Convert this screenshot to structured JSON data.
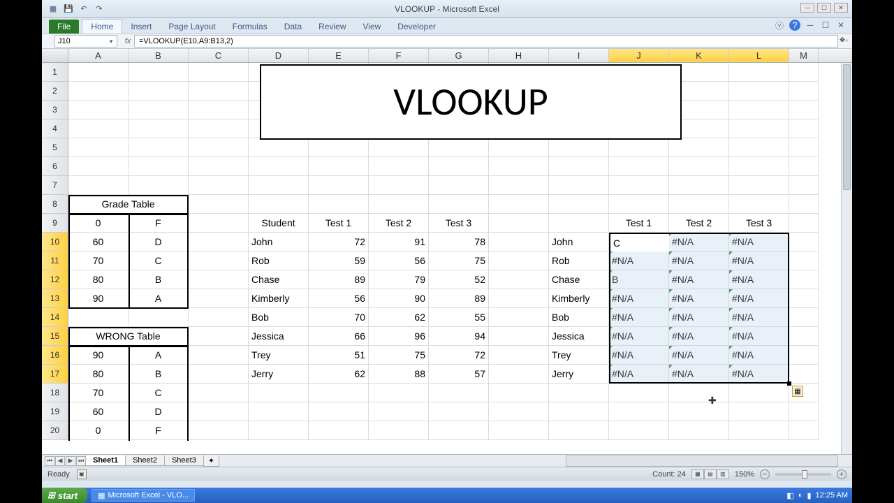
{
  "app": {
    "title": "VLOOKUP - Microsoft Excel",
    "namebox": "J10",
    "formula": "=VLOOKUP(E10,A9:B13,2)",
    "status": "Ready",
    "count_label": "Count: 24",
    "zoom": "150%"
  },
  "ribbon": {
    "file": "File",
    "tabs": [
      "Home",
      "Insert",
      "Page Layout",
      "Formulas",
      "Data",
      "Review",
      "View",
      "Developer"
    ]
  },
  "columns": [
    "A",
    "B",
    "C",
    "D",
    "E",
    "F",
    "G",
    "H",
    "I",
    "J",
    "K",
    "L",
    "M"
  ],
  "selected_cols": [
    "J",
    "K",
    "L"
  ],
  "rows": [
    1,
    2,
    3,
    4,
    5,
    6,
    7,
    8,
    9,
    10,
    11,
    12,
    13,
    14,
    15,
    16,
    17,
    18,
    19,
    20
  ],
  "selected_rows": [
    10,
    11,
    12,
    13,
    14,
    15,
    16,
    17
  ],
  "title_cell": "VLOOKUP",
  "grade_table": {
    "header": "Grade Table",
    "rows": [
      [
        "0",
        "F"
      ],
      [
        "60",
        "D"
      ],
      [
        "70",
        "C"
      ],
      [
        "80",
        "B"
      ],
      [
        "90",
        "A"
      ]
    ]
  },
  "wrong_table": {
    "header": "WRONG Table",
    "rows": [
      [
        "90",
        "A"
      ],
      [
        "80",
        "B"
      ],
      [
        "70",
        "C"
      ],
      [
        "60",
        "D"
      ],
      [
        "0",
        "F"
      ]
    ]
  },
  "scores": {
    "headers": [
      "Student",
      "Test 1",
      "Test 2",
      "Test 3"
    ],
    "rows": [
      [
        "John",
        "72",
        "91",
        "78"
      ],
      [
        "Rob",
        "59",
        "56",
        "75"
      ],
      [
        "Chase",
        "89",
        "79",
        "52"
      ],
      [
        "Kimberly",
        "56",
        "90",
        "89"
      ],
      [
        "Bob",
        "70",
        "62",
        "55"
      ],
      [
        "Jessica",
        "66",
        "96",
        "94"
      ],
      [
        "Trey",
        "51",
        "75",
        "72"
      ],
      [
        "Jerry",
        "62",
        "88",
        "57"
      ]
    ]
  },
  "lookup": {
    "headers": [
      "Test 1",
      "Test 2",
      "Test 3"
    ],
    "names": [
      "John",
      "Rob",
      "Chase",
      "Kimberly",
      "Bob",
      "Jessica",
      "Trey",
      "Jerry"
    ],
    "results": [
      [
        "C",
        "#N/A",
        "#N/A"
      ],
      [
        "#N/A",
        "#N/A",
        "#N/A"
      ],
      [
        "B",
        "#N/A",
        "#N/A"
      ],
      [
        "#N/A",
        "#N/A",
        "#N/A"
      ],
      [
        "#N/A",
        "#N/A",
        "#N/A"
      ],
      [
        "#N/A",
        "#N/A",
        "#N/A"
      ],
      [
        "#N/A",
        "#N/A",
        "#N/A"
      ],
      [
        "#N/A",
        "#N/A",
        "#N/A"
      ]
    ]
  },
  "sheets": [
    "Sheet1",
    "Sheet2",
    "Sheet3"
  ],
  "taskbar": {
    "start": "start",
    "app": "Microsoft Excel - VLO...",
    "time": "12:25 AM"
  }
}
